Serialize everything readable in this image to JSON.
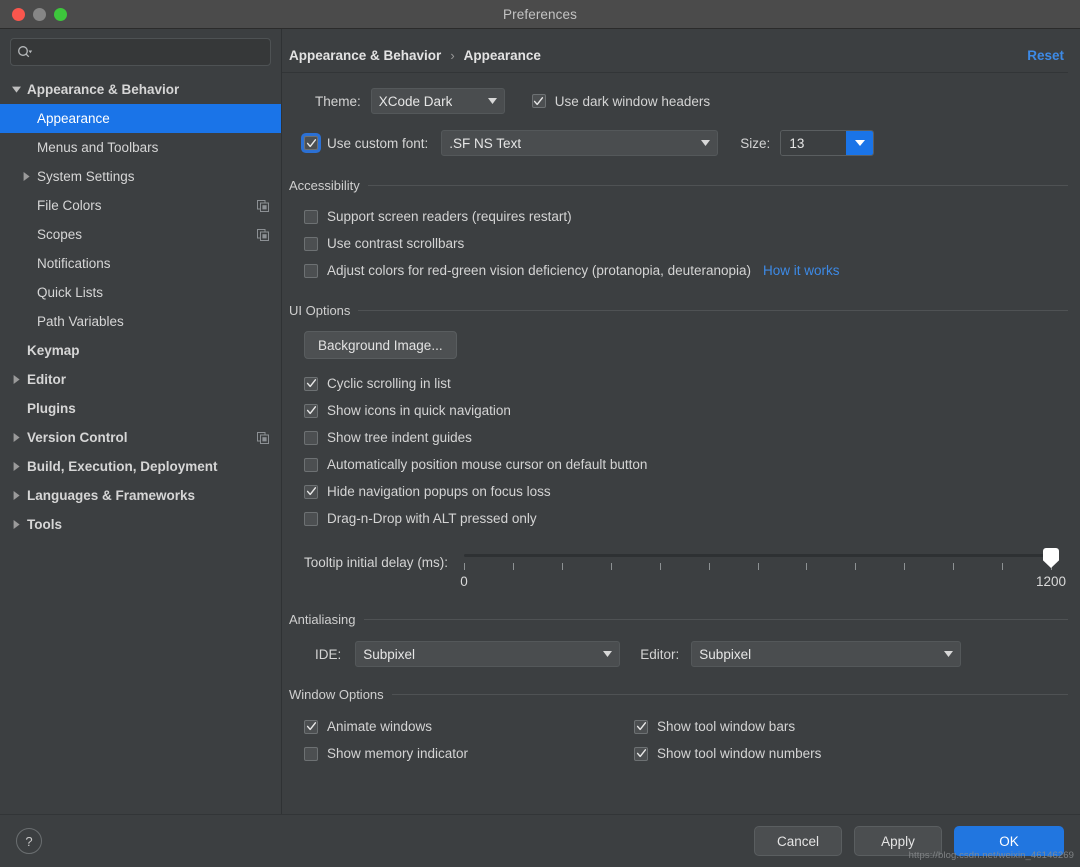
{
  "window": {
    "title": "Preferences",
    "traffic_lights": [
      "close",
      "minimize",
      "zoom"
    ]
  },
  "colors": {
    "accent": "#1a74e8",
    "link": "#3d8ae6",
    "selection": "#1a74e8",
    "window_bg": "#3c3f41",
    "titlebar_bg": "#4b4b4b",
    "traffic_red": "#f9564d",
    "traffic_yellow": "#868686",
    "traffic_green": "#3dc63c"
  },
  "sidebar": {
    "search": {
      "value": "",
      "placeholder": ""
    },
    "items": [
      {
        "label": "Appearance & Behavior",
        "indent": 0,
        "bold": true,
        "arrow": "down",
        "selected": false,
        "trailing": null
      },
      {
        "label": "Appearance",
        "indent": 1,
        "bold": false,
        "arrow": "none",
        "selected": true,
        "trailing": null
      },
      {
        "label": "Menus and Toolbars",
        "indent": 1,
        "bold": false,
        "arrow": "none",
        "selected": false,
        "trailing": null
      },
      {
        "label": "System Settings",
        "indent": 1,
        "bold": false,
        "arrow": "right",
        "selected": false,
        "trailing": null
      },
      {
        "label": "File Colors",
        "indent": 1,
        "bold": false,
        "arrow": "none",
        "selected": false,
        "trailing": "copy-icon"
      },
      {
        "label": "Scopes",
        "indent": 1,
        "bold": false,
        "arrow": "none",
        "selected": false,
        "trailing": "copy-icon"
      },
      {
        "label": "Notifications",
        "indent": 1,
        "bold": false,
        "arrow": "none",
        "selected": false,
        "trailing": null
      },
      {
        "label": "Quick Lists",
        "indent": 1,
        "bold": false,
        "arrow": "none",
        "selected": false,
        "trailing": null
      },
      {
        "label": "Path Variables",
        "indent": 1,
        "bold": false,
        "arrow": "none",
        "selected": false,
        "trailing": null
      },
      {
        "label": "Keymap",
        "indent": 0,
        "bold": true,
        "arrow": "none",
        "selected": false,
        "trailing": null
      },
      {
        "label": "Editor",
        "indent": 0,
        "bold": true,
        "arrow": "right",
        "selected": false,
        "trailing": null
      },
      {
        "label": "Plugins",
        "indent": 0,
        "bold": true,
        "arrow": "none",
        "selected": false,
        "trailing": null
      },
      {
        "label": "Version Control",
        "indent": 0,
        "bold": true,
        "arrow": "right",
        "selected": false,
        "trailing": "copy-icon"
      },
      {
        "label": "Build, Execution, Deployment",
        "indent": 0,
        "bold": true,
        "arrow": "right",
        "selected": false,
        "trailing": null
      },
      {
        "label": "Languages & Frameworks",
        "indent": 0,
        "bold": true,
        "arrow": "right",
        "selected": false,
        "trailing": null
      },
      {
        "label": "Tools",
        "indent": 0,
        "bold": true,
        "arrow": "right",
        "selected": false,
        "trailing": null
      }
    ]
  },
  "breadcrumb": {
    "parent": "Appearance & Behavior",
    "separator": "›",
    "current": "Appearance",
    "reset_label": "Reset"
  },
  "main": {
    "theme": {
      "label": "Theme:",
      "value": "XCode Dark",
      "dark_headers_label": "Use dark window headers",
      "dark_headers_checked": true
    },
    "font": {
      "custom_font_label": "Use custom font:",
      "custom_font_checked": true,
      "custom_font_focused": true,
      "value": ".SF NS Text",
      "size_label": "Size:",
      "size_value": "13"
    },
    "accessibility": {
      "title": "Accessibility",
      "options": [
        {
          "label": "Support screen readers (requires restart)",
          "checked": false
        },
        {
          "label": "Use contrast scrollbars",
          "checked": false
        },
        {
          "label": "Adjust colors for red-green vision deficiency (protanopia, deuteranopia)",
          "checked": false
        }
      ],
      "link_label": "How it works"
    },
    "ui_options": {
      "title": "UI Options",
      "background_image_label": "Background Image...",
      "options": [
        {
          "label": "Cyclic scrolling in list",
          "checked": true
        },
        {
          "label": "Show icons in quick navigation",
          "checked": true
        },
        {
          "label": "Show tree indent guides",
          "checked": false
        },
        {
          "label": "Automatically position mouse cursor on default button",
          "checked": false
        },
        {
          "label": "Hide navigation popups on focus loss",
          "checked": true
        },
        {
          "label": "Drag-n-Drop with ALT pressed only",
          "checked": false
        }
      ],
      "tooltip_delay": {
        "label": "Tooltip initial delay (ms):",
        "min": "0",
        "max": "1200",
        "value": 1200,
        "tick_count": 13
      }
    },
    "antialiasing": {
      "title": "Antialiasing",
      "ide_label": "IDE:",
      "ide_value": "Subpixel",
      "editor_label": "Editor:",
      "editor_value": "Subpixel"
    },
    "window_options": {
      "title": "Window Options",
      "left": [
        {
          "label": "Animate windows",
          "checked": true
        },
        {
          "label": "Show memory indicator",
          "checked": false
        }
      ],
      "right": [
        {
          "label": "Show tool window bars",
          "checked": true
        },
        {
          "label": "Show tool window numbers",
          "checked": true
        }
      ]
    }
  },
  "footer": {
    "help_label": "?",
    "cancel_label": "Cancel",
    "apply_label": "Apply",
    "ok_label": "OK"
  },
  "watermark": "https://blog.csdn.net/weixin_46146269"
}
